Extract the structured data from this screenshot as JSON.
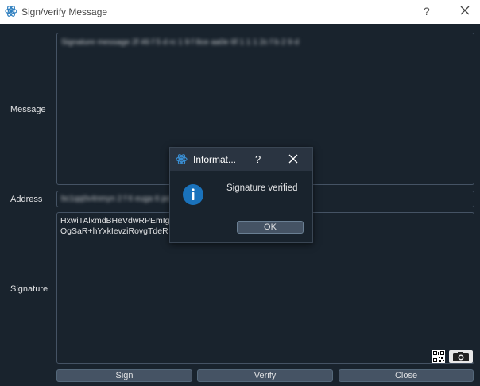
{
  "window": {
    "title": "Sign/verify Message",
    "help_label": "?",
    "icon": "electrum-icon"
  },
  "form": {
    "message_label": "Message",
    "message_value": "Signature message 2f 46 f 5 d rc 1 9 f 8ce aa0e 6f 1 1 1 2c f b 2 9 d",
    "address_label": "Address",
    "address_value": "bc1qq0v4nmyn 2 f 6 euga 6 pcs",
    "signature_label": "Signature",
    "signature_line1": "HxwiTAlxmdBHeVdwRPEmIgG",
    "signature_line2": "OgSaR+hYxkIevziRovgTdeR"
  },
  "buttons": {
    "sign": "Sign",
    "verify": "Verify",
    "close": "Close"
  },
  "dialog": {
    "title": "Informat...",
    "help_label": "?",
    "message": "Signature verified",
    "ok": "OK"
  },
  "colors": {
    "background": "#19232d",
    "button": "#455364",
    "accent": "#1a72bb"
  }
}
